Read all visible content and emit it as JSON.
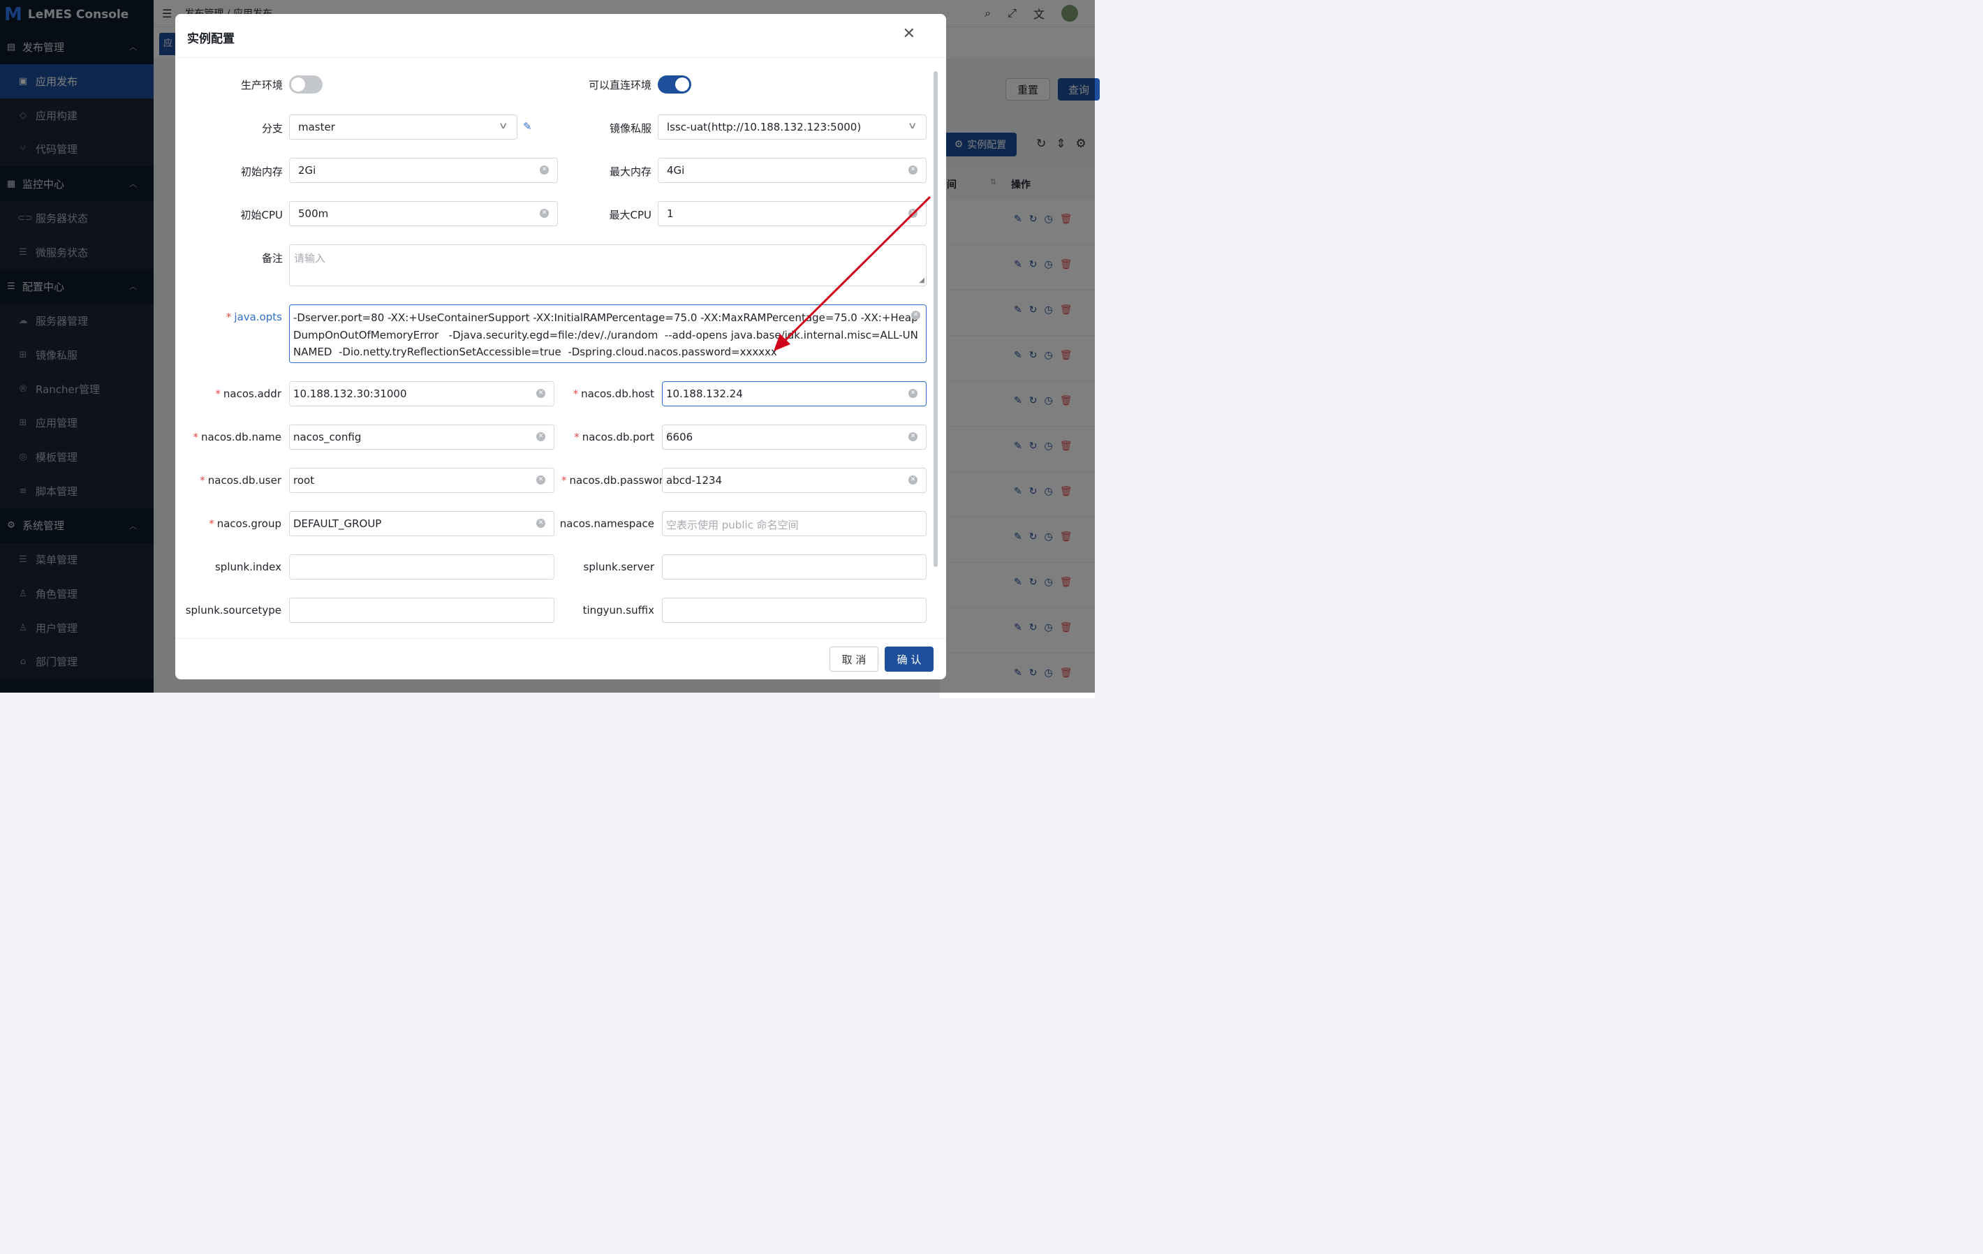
{
  "app": {
    "brand": "LeMES Console",
    "breadcrumb": "发布管理 / 应用发布",
    "tab_label": "应"
  },
  "sidebar": {
    "groups": [
      {
        "label": "发布管理",
        "items": [
          "应用发布",
          "应用构建",
          "代码管理"
        ]
      },
      {
        "label": "监控中心",
        "items": [
          "服务器状态",
          "微服务状态"
        ]
      },
      {
        "label": "配置中心",
        "items": [
          "服务器管理",
          "镜像私服",
          "Rancher管理",
          "应用管理",
          "模板管理",
          "脚本管理"
        ]
      },
      {
        "label": "系统管理",
        "items": [
          "菜单管理",
          "角色管理",
          "用户管理",
          "部门管理"
        ]
      }
    ],
    "active_item": "应用发布"
  },
  "background": {
    "reset_label": "重置",
    "query_label": "查询",
    "instance_btn": "实例配置",
    "col_time_fragment": "间",
    "col_ops": "操作",
    "row_count": 11
  },
  "dialog": {
    "title": "实例配置",
    "fields": {
      "prod_env": {
        "label": "生产环境",
        "on": false
      },
      "direct_env": {
        "label": "可以直连环境",
        "on": true
      },
      "branch": {
        "label": "分支",
        "value": "master"
      },
      "registry": {
        "label": "镜像私服",
        "value": "lssc-uat(http://10.188.132.123:5000)"
      },
      "init_mem": {
        "label": "初始内存",
        "value": "2Gi"
      },
      "max_mem": {
        "label": "最大内存",
        "value": "4Gi"
      },
      "init_cpu": {
        "label": "初始CPU",
        "value": "500m"
      },
      "max_cpu": {
        "label": "最大CPU",
        "value": "1"
      },
      "remark": {
        "label": "备注",
        "placeholder": "请输入"
      },
      "java_opts": {
        "label": "java.opts",
        "value": "-Dserver.port=80 -XX:+UseContainerSupport -XX:InitialRAMPercentage=75.0 -XX:MaxRAMPercentage=75.0 -XX:+HeapDumpOnOutOfMemoryError   -Djava.security.egd=file:/dev/./urandom  --add-opens java.base/jdk.internal.misc=ALL-UNNAMED  -Dio.netty.tryReflectionSetAccessible=true  -Dspring.cloud.nacos.password=xxxxxx"
      },
      "nacos_addr": {
        "label": "nacos.addr",
        "value": "10.188.132.30:31000"
      },
      "nacos_db_host": {
        "label": "nacos.db.host",
        "value": "10.188.132.24"
      },
      "nacos_db_name": {
        "label": "nacos.db.name",
        "value": "nacos_config"
      },
      "nacos_db_port": {
        "label": "nacos.db.port",
        "value": "6606"
      },
      "nacos_db_user": {
        "label": "nacos.db.user",
        "value": "root"
      },
      "nacos_db_password": {
        "label": "nacos.db.passwor",
        "value": "abcd-1234"
      },
      "nacos_group": {
        "label": "nacos.group",
        "value": "DEFAULT_GROUP"
      },
      "nacos_namespace": {
        "label": "nacos.namespace",
        "placeholder": "空表示使用 public 命名空间"
      },
      "splunk_index": {
        "label": "splunk.index",
        "value": ""
      },
      "splunk_server": {
        "label": "splunk.server",
        "value": ""
      },
      "splunk_sourcetype": {
        "label": "splunk.sourcetype",
        "value": ""
      },
      "tingyun_suffix": {
        "label": "tingyun.suffix",
        "value": ""
      }
    },
    "cancel_label": "取 消",
    "ok_label": "确 认"
  },
  "colors": {
    "primary": "#1d4f9c",
    "sidebar_bg": "#0f1a2a",
    "required": "#e04b4b",
    "annotation_arrow": "#d0021b"
  }
}
